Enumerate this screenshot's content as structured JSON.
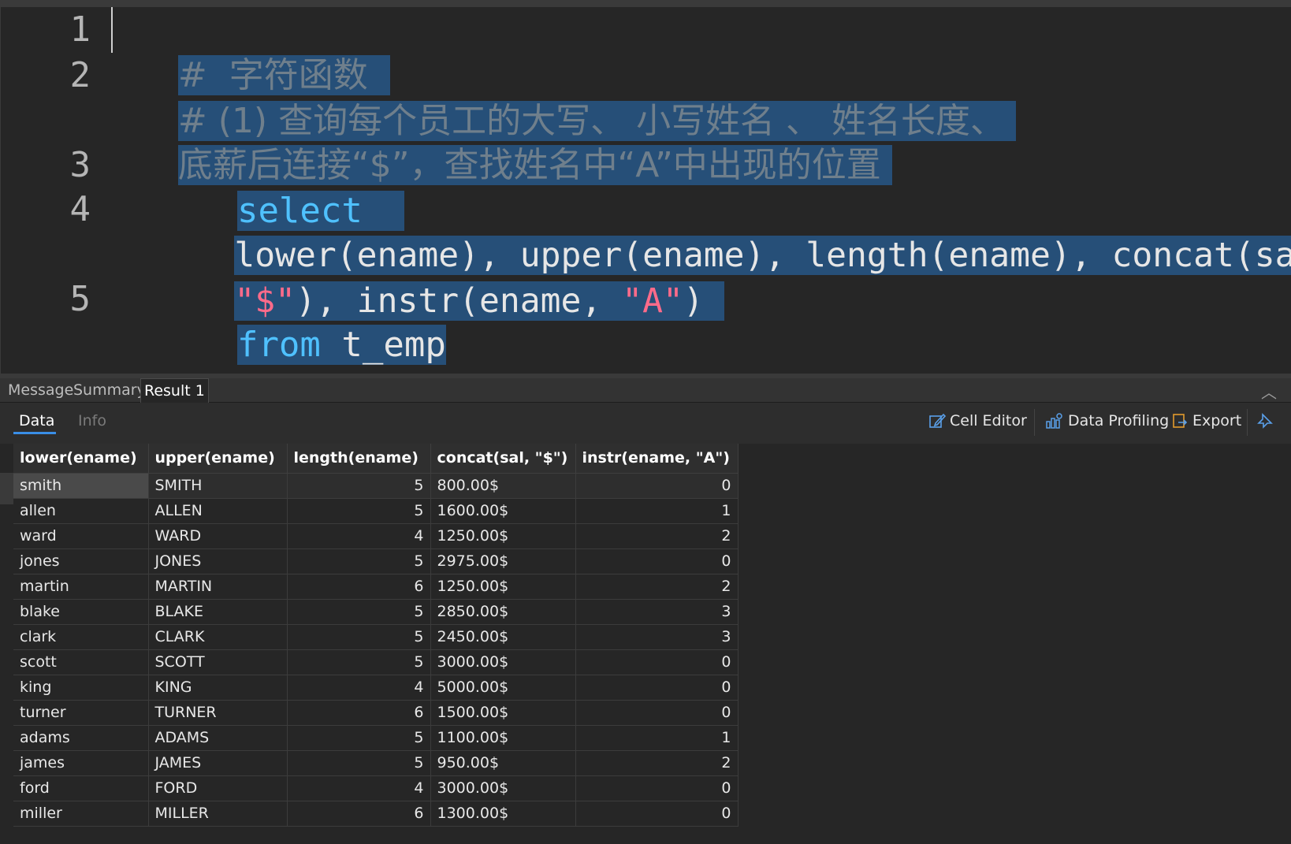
{
  "editor": {
    "line_numbers": [
      "1",
      "2",
      "3",
      "4",
      "5"
    ],
    "line1": "#  字符函数",
    "line2a": "# (1) 查询每个员工的大写、 小写姓名 、 姓名长度、",
    "line2b": "底薪后连接“$”，查找姓名中“A”中出现的位置",
    "line3_kw": "select",
    "line4_a": "lower(ename), upper(ename), length(ename), concat(sal,",
    "line4_b_str1": "\"$\"",
    "line4_b_mid": "), instr(ename, ",
    "line4_b_str2": "\"A\"",
    "line4_b_end": ")",
    "line5_kw": "from",
    "line5_rest": " t_emp"
  },
  "tabs": {
    "message": "Message",
    "summary": "Summary",
    "result": "Result 1"
  },
  "subtabs": {
    "data": "Data",
    "info": "Info"
  },
  "toolbar": {
    "cell_editor": "Cell Editor",
    "data_profiling": "Data Profiling",
    "export": "Export"
  },
  "grid": {
    "columns": [
      "lower(ename)",
      "upper(ename)",
      "length(ename)",
      "concat(sal, \"$\")",
      "instr(ename, \"A\")"
    ],
    "rows": [
      [
        "smith",
        "SMITH",
        "5",
        "800.00$",
        "0"
      ],
      [
        "allen",
        "ALLEN",
        "5",
        "1600.00$",
        "1"
      ],
      [
        "ward",
        "WARD",
        "4",
        "1250.00$",
        "2"
      ],
      [
        "jones",
        "JONES",
        "5",
        "2975.00$",
        "0"
      ],
      [
        "martin",
        "MARTIN",
        "6",
        "1250.00$",
        "2"
      ],
      [
        "blake",
        "BLAKE",
        "5",
        "2850.00$",
        "3"
      ],
      [
        "clark",
        "CLARK",
        "5",
        "2450.00$",
        "3"
      ],
      [
        "scott",
        "SCOTT",
        "5",
        "3000.00$",
        "0"
      ],
      [
        "king",
        "KING",
        "4",
        "5000.00$",
        "0"
      ],
      [
        "turner",
        "TURNER",
        "6",
        "1500.00$",
        "0"
      ],
      [
        "adams",
        "ADAMS",
        "5",
        "1100.00$",
        "1"
      ],
      [
        "james",
        "JAMES",
        "5",
        "950.00$",
        "2"
      ],
      [
        "ford",
        "FORD",
        "4",
        "3000.00$",
        "0"
      ],
      [
        "miller",
        "MILLER",
        "6",
        "1300.00$",
        "0"
      ]
    ]
  }
}
